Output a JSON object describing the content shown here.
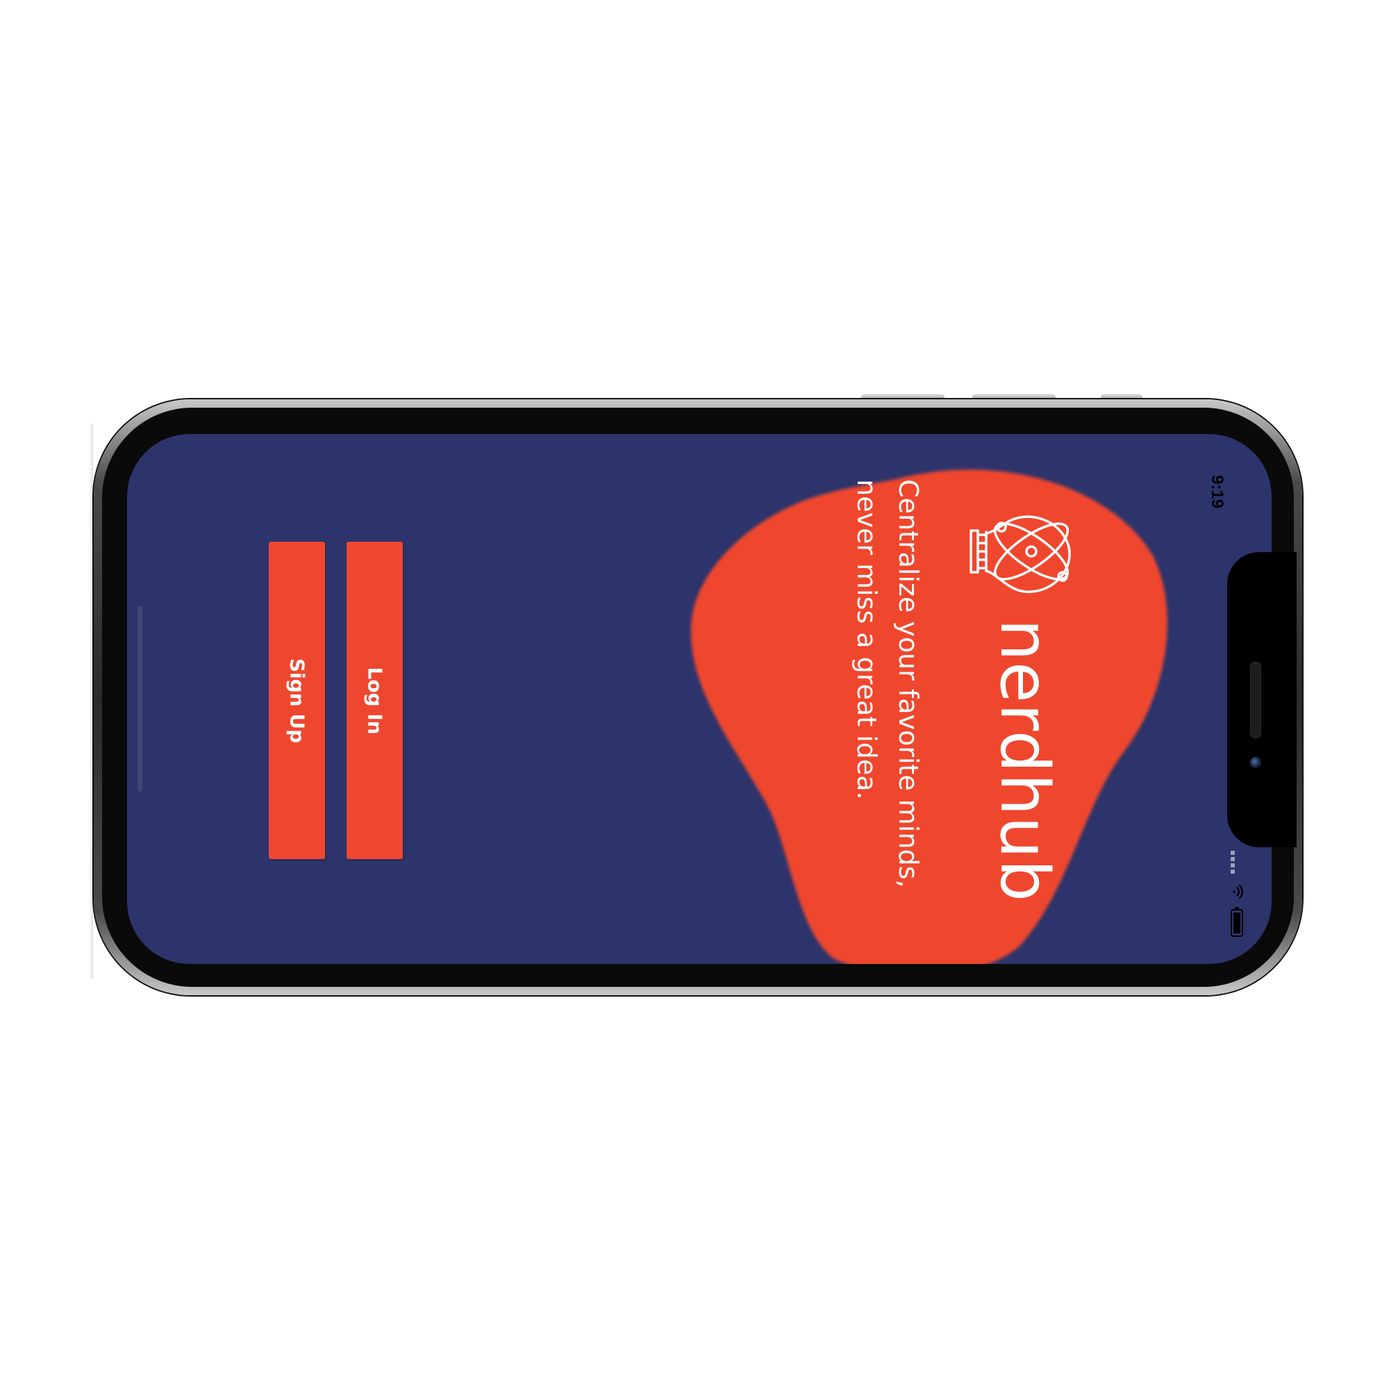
{
  "status_bar": {
    "time": "9:19",
    "icons": [
      "signal-icon",
      "wifi-icon",
      "battery-icon"
    ]
  },
  "brand": {
    "name": "nerdhub",
    "logo_icon": "lightbulb-atom-icon",
    "tagline_line1": "Centralize your favorite minds,",
    "tagline_line2": "never miss a great idea."
  },
  "actions": {
    "login_label": "Log In",
    "signup_label": "Sign Up"
  },
  "colors": {
    "background": "#2d346b",
    "accent": "#ee472f",
    "text_on_accent": "#ffffff"
  }
}
